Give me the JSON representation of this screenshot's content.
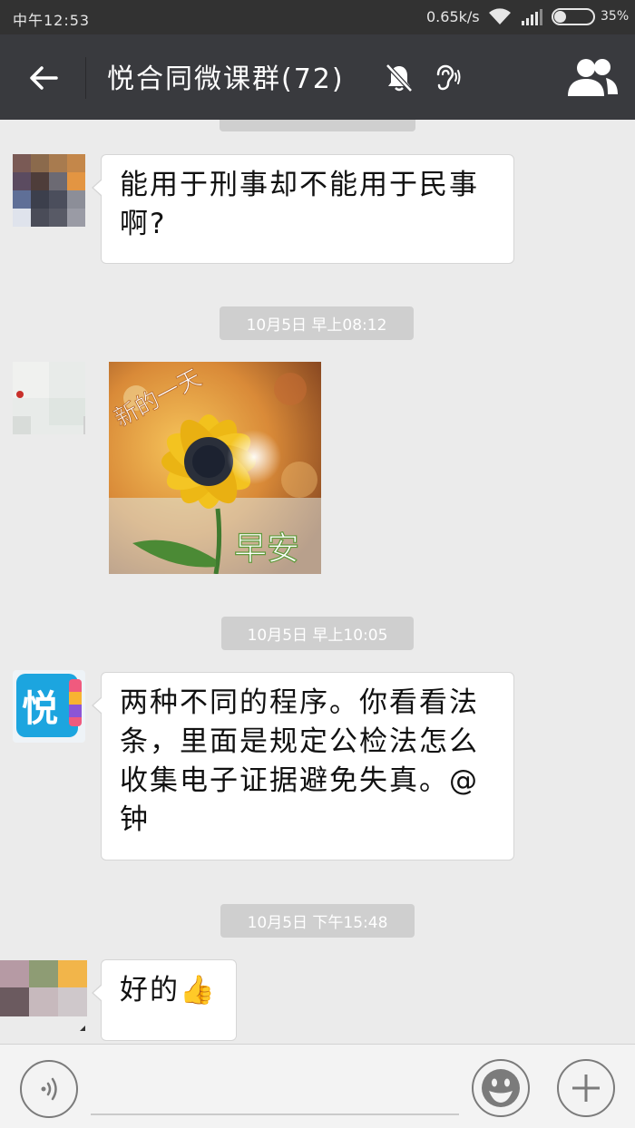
{
  "status_bar": {
    "time": "中午12:53",
    "net_speed": "0.65k/s",
    "battery": "35%"
  },
  "header": {
    "title": "悦合同微课群(72)"
  },
  "messages": [
    {
      "text": "能用于刑事却不能用于民事啊?"
    },
    {
      "timestamp": "10月5日 早上08:12",
      "sticker_caption_top": "新的一天",
      "sticker_caption_bottom": "早安"
    },
    {
      "timestamp": "10月5日 早上10:05",
      "avatar_glyph": "悦",
      "text": "两种不同的程序。你看看法条，里面是规定公检法怎么收集电子证据避免失真。@钟"
    },
    {
      "timestamp": "10月5日 下午15:48",
      "text": "好的",
      "emoji": "👍"
    }
  ],
  "colors": {
    "title_bar": "#393a3e",
    "status_bar": "#323232",
    "chat_bg": "#ebebeb",
    "stamp_bg": "#cfcfcf",
    "bubble_bg": "#ffffff"
  },
  "icons": {
    "back": "back-arrow-icon",
    "mute": "bell-off-icon",
    "earpiece": "earpiece-icon",
    "members": "group-members-icon",
    "voice": "voice-input-icon",
    "emoji": "emoji-icon",
    "more": "plus-icon"
  }
}
